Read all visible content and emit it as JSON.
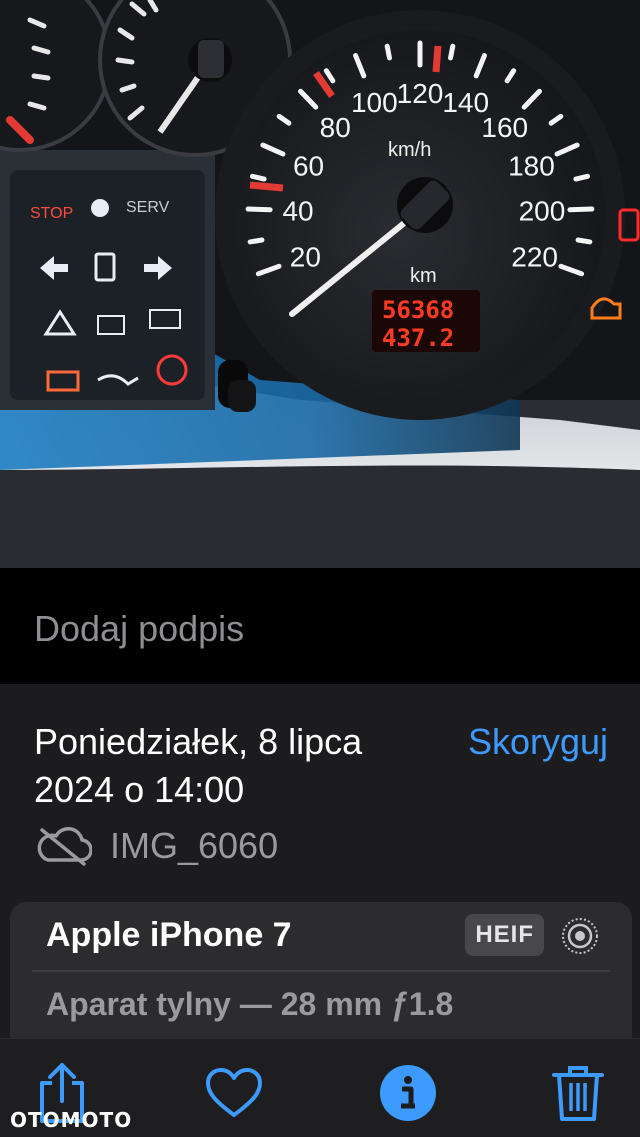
{
  "photo": {
    "speedometer_unit": "km/h",
    "speed_marks": [
      "20",
      "40",
      "60",
      "80",
      "100",
      "120",
      "140",
      "160",
      "180",
      "200",
      "220"
    ],
    "odometer_unit": "km",
    "odometer_total": "56368",
    "odometer_trip": "437.2",
    "warning_stop": "STOP",
    "warning_serv": "SERV"
  },
  "caption": {
    "placeholder": "Dodaj podpis"
  },
  "info": {
    "date_line1": "Poniedziałek, 8 lipca",
    "date_line2": "2024 o 14:00",
    "adjust_label": "Skoryguj",
    "file_name": "IMG_6060",
    "device_name": "Apple iPhone 7",
    "format": "HEIF",
    "lens_info": "Aparat tylny — 28 mm ƒ1.8"
  },
  "toolbar": {
    "accent_color": "#3d9bff",
    "icons": [
      "share-icon",
      "heart-icon",
      "info-icon",
      "trash-icon"
    ]
  },
  "watermark": "OTOMOTO"
}
